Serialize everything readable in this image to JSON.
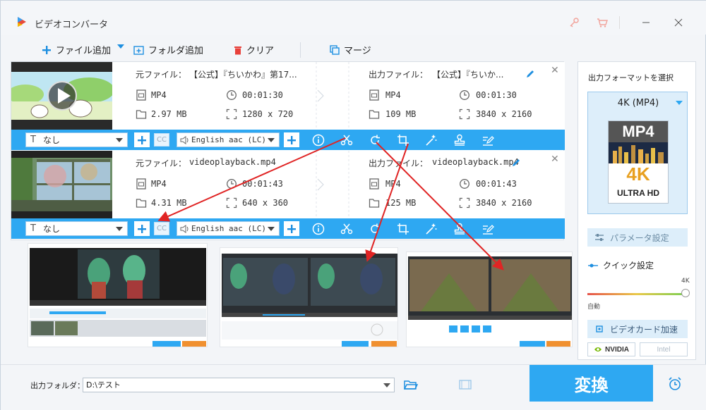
{
  "window": {
    "title": "ビデオコンバータ"
  },
  "toolbar": {
    "add_file": "ファイル追加",
    "add_folder": "フォルダ追加",
    "clear": "クリア",
    "merge": "マージ"
  },
  "files": [
    {
      "source_label": "元ファイル：",
      "source_name": "【公式】『ちいかわ』第17...",
      "output_label": "出力ファイル：",
      "output_name": "【公式】『ちいか...",
      "src_format": "MP4",
      "src_duration": "00:01:30",
      "src_size": "2.97 MB",
      "src_resolution": "1280 x 720",
      "out_format": "MP4",
      "out_duration": "00:01:30",
      "out_size": "109 MB",
      "out_resolution": "3840 x 2160",
      "subtitle": "なし",
      "audio": "English aac (LC)",
      "cc": "CC"
    },
    {
      "source_label": "元ファイル：",
      "source_name": "videoplayback.mp4",
      "output_label": "出力ファイル：",
      "output_name": "videoplayback.mp4",
      "src_format": "MP4",
      "src_duration": "00:01:43",
      "src_size": "4.31 MB",
      "src_resolution": "640 x 360",
      "out_format": "MP4",
      "out_duration": "00:01:43",
      "out_size": "125 MB",
      "out_resolution": "3840 x 2160",
      "subtitle": "なし",
      "audio": "English aac (LC)",
      "cc": "CC"
    }
  ],
  "right_panel": {
    "title": "出力フォーマットを選択",
    "format": "4K (MP4)",
    "format_badge_top": "MP4",
    "format_badge_4k": "4K",
    "format_badge_uhd": "ULTRA HD",
    "param_button": "パラメータ設定",
    "quick_label": "クイック設定",
    "slider_max": "4K",
    "slider_min": "自動",
    "gpu_button": "ビデオカード加速",
    "gpu_nvidia": "NVIDIA",
    "gpu_intel": "Intel"
  },
  "bottom": {
    "output_folder_label": "出力フォルダ：",
    "output_folder_value": "D:\\テスト",
    "convert": "変換"
  },
  "colors": {
    "accent": "#2ea8f2",
    "arrow": "#e02424"
  }
}
